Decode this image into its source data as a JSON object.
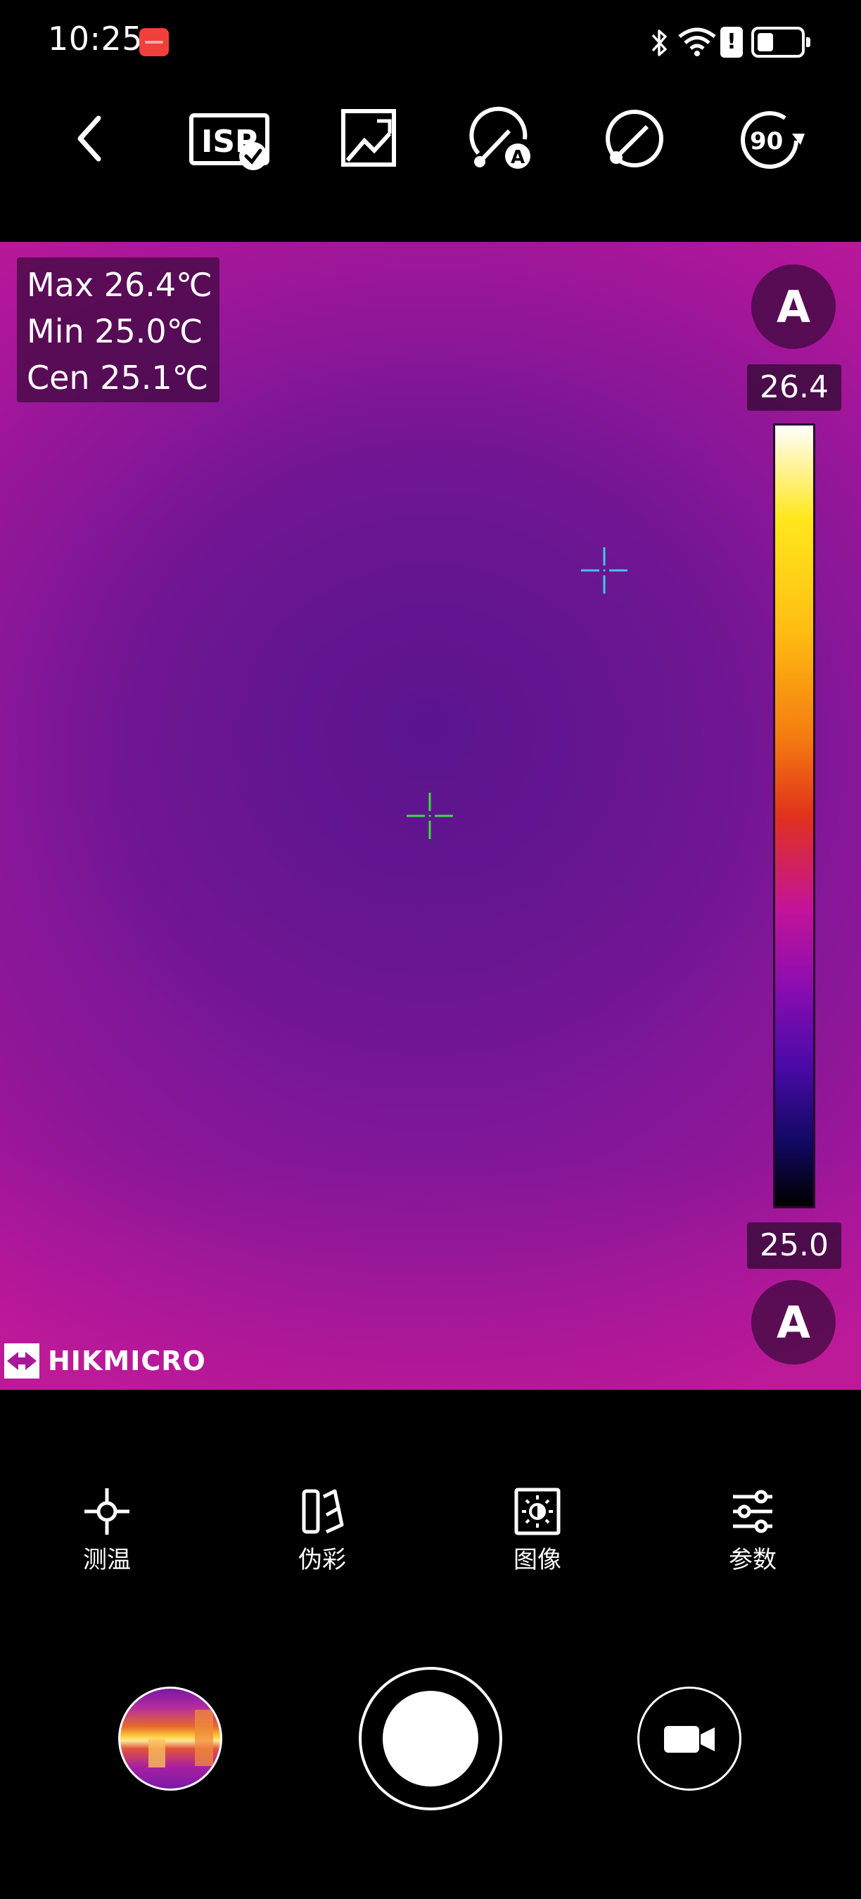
{
  "status_bar": {
    "time": "10:25",
    "notification_icon": "huawei-app-icon",
    "icons": [
      "bluetooth-icon",
      "wifi-icon",
      "alert-icon",
      "battery-icon"
    ]
  },
  "toolbar": {
    "items": [
      "back-icon",
      "isp-icon",
      "image-gallery-icon",
      "auto-measure-icon",
      "measure-line-icon",
      "rotate-90-icon"
    ],
    "isp_label": "ISP",
    "rotate_label": "90"
  },
  "thermal": {
    "readouts": [
      {
        "label": "Max",
        "value": "26.4℃"
      },
      {
        "label": "Min",
        "value": "25.0℃"
      },
      {
        "label": "Cen",
        "value": "25.1℃"
      }
    ],
    "scale_max": "26.4",
    "scale_min": "25.0",
    "auto_label": "A",
    "palette": [
      "#ffffff",
      "#ffe71c",
      "#f57b10",
      "#c3139a",
      "#4a0aa8",
      "#000000"
    ],
    "crosshair_colors": {
      "max": "#3fc8e4",
      "center": "#37e03a"
    }
  },
  "brand": {
    "name": "HIKMICRO"
  },
  "tabs": [
    {
      "label": "测温",
      "icon": "crosshair-measure-icon"
    },
    {
      "label": "伪彩",
      "icon": "palette-icon"
    },
    {
      "label": "图像",
      "icon": "image-brightness-icon"
    },
    {
      "label": "参数",
      "icon": "sliders-icon"
    }
  ],
  "capture": {
    "gallery": "gallery-thumbnail",
    "shutter": "shutter-button",
    "video": "video-camera-icon"
  }
}
